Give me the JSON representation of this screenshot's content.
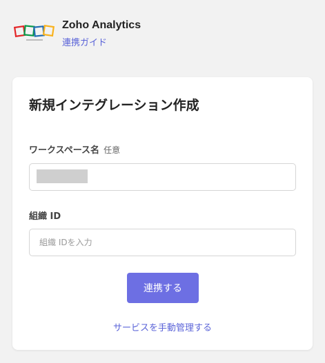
{
  "header": {
    "app_name": "Zoho Analytics",
    "guide_link": "連携ガイド",
    "logo_icon": "zoho-logo-icon"
  },
  "form": {
    "title": "新規インテグレーション作成",
    "workspace": {
      "label": "ワークスペース名",
      "optional": "任意",
      "value": ""
    },
    "org_id": {
      "label": "組織 ID",
      "placeholder": "組織 IDを入力",
      "value": ""
    },
    "submit_label": "連携する",
    "manual_link": "サービスを手動管理する"
  },
  "colors": {
    "accent": "#6d6fe3",
    "link": "#5a63d8",
    "background": "#f2f2f2",
    "logo_red": "#e42527",
    "logo_green": "#089949",
    "logo_blue": "#226db4",
    "logo_yellow": "#f9b21d"
  }
}
